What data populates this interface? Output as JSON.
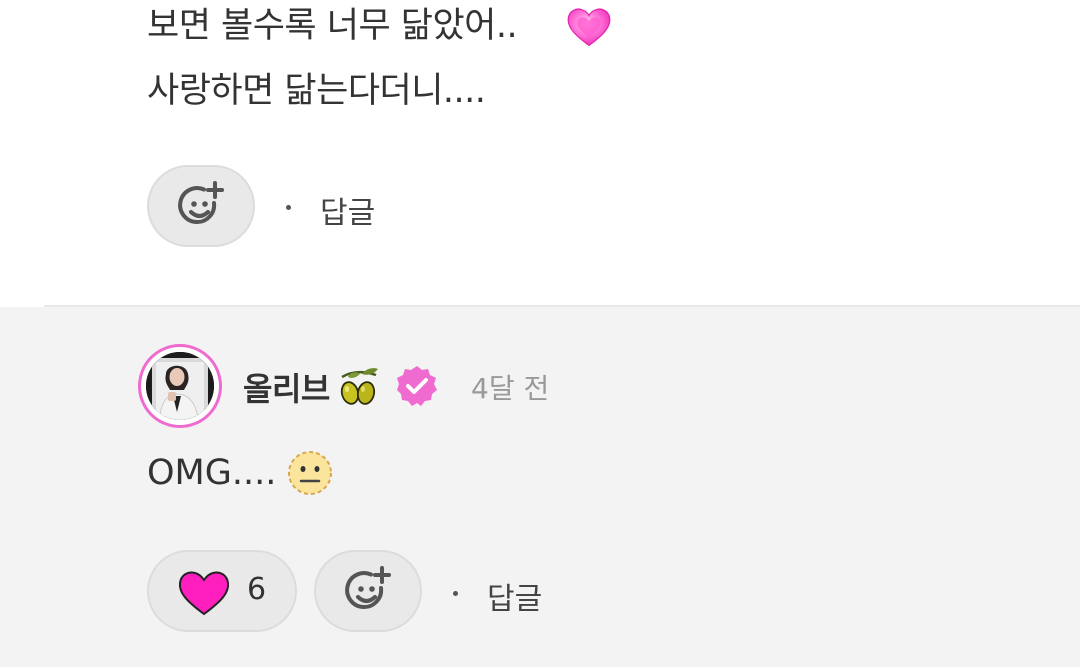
{
  "comment_1": {
    "line_1": "보면 볼수록 너무 닮았어..",
    "line_2": "사랑하면 닮는다더니....",
    "reply_label": "답글"
  },
  "comment_2": {
    "username": "올리브",
    "timestamp": "4달 전",
    "text": "OMG....",
    "like_count": "6",
    "reply_label": "답글"
  },
  "colors": {
    "accent_pink": "#f06bd0",
    "heart_pink": "#ff2ec4",
    "background_top": "#ffffff",
    "background_bottom": "#f3f3f3"
  },
  "icons": {
    "add_reaction": "add-reaction-icon",
    "heart": "heart-icon",
    "verified": "verified-badge-icon",
    "olive": "olive-emoji",
    "neutral_face": "neutral-face-emoji",
    "growing_heart": "growing-heart-emoji"
  }
}
